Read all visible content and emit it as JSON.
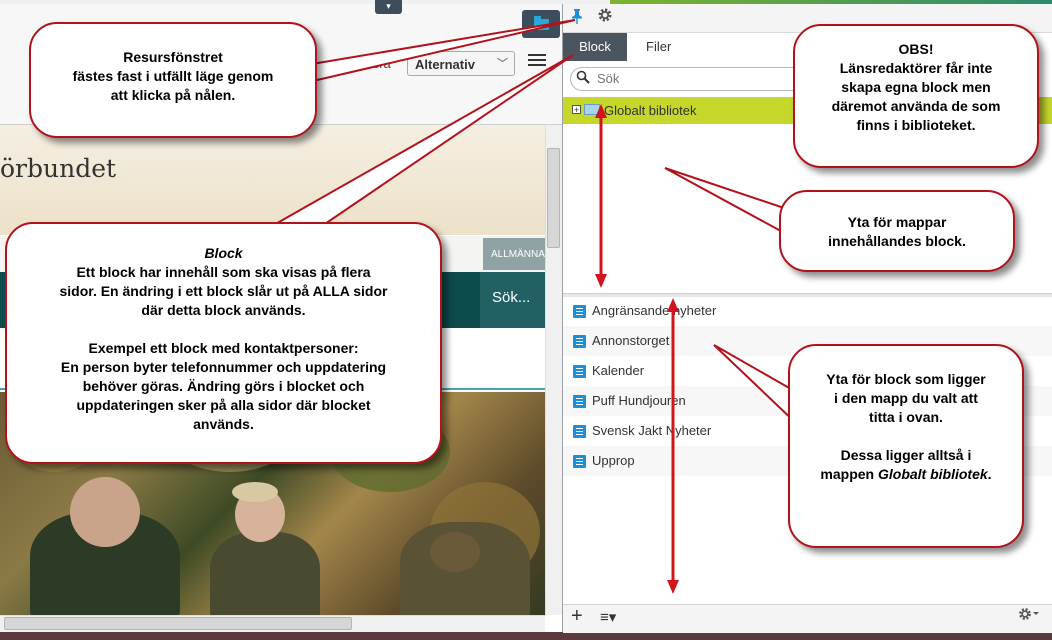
{
  "toolbar": {
    "toggle_glyph": "▾",
    "publish_label": "publicera",
    "options_select": "Alternativ",
    "chevron": "﹀"
  },
  "site": {
    "title": "örbundet",
    "nav_item": "ALLMÄNNA",
    "search": "Sök..."
  },
  "pane": {
    "tabs": [
      "Block",
      "Filer"
    ],
    "search_placeholder": "Sök",
    "folder": "Globalt bibliotek",
    "blocks": [
      "Angränsande nyheter",
      "Annonstorget",
      "Kalender",
      "Puff Hundjouren",
      "Svensk Jakt Nyheter",
      "Upprop"
    ]
  },
  "callouts": {
    "pin": [
      "Resursfönstret",
      "fästes fast i utfällt läge genom",
      "att klicka på nålen."
    ],
    "obs": [
      "OBS!",
      "Länsredaktörer får inte",
      "skapa egna block men",
      "däremot använda de som",
      "finns i biblioteket."
    ],
    "folders": [
      "Yta för mappar",
      "innehållandes block."
    ],
    "block_title": "Block",
    "block_lines": [
      "Ett block har innehåll som ska visas på flera",
      "sidor. En ändring i ett block slår ut på ALLA sidor",
      "där detta block används.",
      "",
      "Exempel ett block med kontaktpersoner:",
      "En person byter telefonnummer och uppdatering",
      "behöver göras. Ändring görs i blocket och",
      "uppdateringen sker på alla sidor där blocket",
      "används."
    ],
    "area_lines": [
      "Yta för block som ligger",
      "i den mapp du valt att",
      "titta i ovan.",
      "",
      "Dessa ligger alltså i",
      "mappen"
    ],
    "area_folder": "Globalt bibliotek",
    "area_end": "."
  },
  "colors": {
    "accent_red": "#b3121b",
    "folder_highlight": "#c5d72a",
    "tab_active": "#4a5560",
    "block_icon": "#1c8fd9"
  },
  "icons": {
    "pin": "pin-icon",
    "gear": "gear-icon",
    "search": "search-icon",
    "add": "plus-icon",
    "menu": "menu-icon"
  }
}
